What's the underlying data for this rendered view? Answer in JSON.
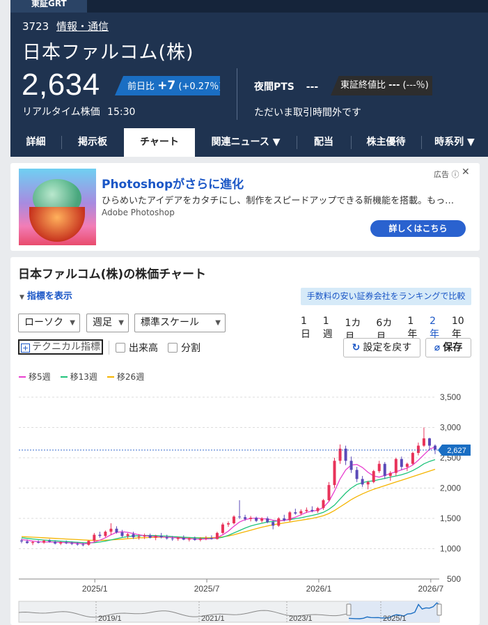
{
  "header": {
    "market": "東証GRT",
    "code": "3723",
    "industry": "情報・通信",
    "company": "日本ファルコム(株)",
    "price": "2,634",
    "change_label": "前日比",
    "change_value": "+7",
    "change_pct": "(+0.27％)",
    "realtime_label": "リアルタイム株価",
    "realtime_time": "15:30",
    "pts_label": "夜間PTS",
    "pts_value": "---",
    "close_label": "東証終値比",
    "close_value": "---",
    "close_pct": "(---％)",
    "notrade": "ただいま取引時間外です"
  },
  "tabs": [
    {
      "label": "詳細"
    },
    {
      "label": "掲示板"
    },
    {
      "label": "チャート"
    },
    {
      "label": "関連ニュース ▼"
    },
    {
      "label": "配当"
    },
    {
      "label": "株主優待"
    },
    {
      "label": "時系列 ▼"
    }
  ],
  "ad": {
    "title": "Photoshopがさらに進化",
    "text": "ひらめいたアイデアをカタチにし、制作をスピードアップできる新機能を搭載。もっ…",
    "brand": "Adobe Photoshop",
    "label": "広告",
    "button": "詳しくはこちら"
  },
  "controls": {
    "title": "日本ファルコム(株)の株価チャート",
    "indicator_link": "指標を表示",
    "broker_button": "手数料の安い証券会社をランキングで比較",
    "chart_type": "ローソク",
    "interval": "週足",
    "scale": "標準スケール",
    "periods": [
      "1日",
      "1週",
      "1カ月",
      "6カ月",
      "1年",
      "2年",
      "10年"
    ],
    "active_period": "2年",
    "tech_button": "テクニカル指標",
    "volume_label": "出来高",
    "split_label": "分割",
    "reset_button": "設定を戻す",
    "save_button": "保存"
  },
  "chart_data": {
    "type": "candlestick",
    "series": [
      {
        "name": "移5週",
        "color": "#e83fcf"
      },
      {
        "name": "移13週",
        "color": "#1fc37a"
      },
      {
        "name": "移26週",
        "color": "#f5b400"
      }
    ],
    "yticks": [
      "3,500",
      "3,000",
      "2,500",
      "2,000",
      "1,500",
      "1,000",
      "500"
    ],
    "ylim": [
      500,
      3500
    ],
    "xticks": [
      "2025/1",
      "2025/7",
      "2026/1",
      "2026/7"
    ],
    "last_price_label": "2,627",
    "last_price": 2627,
    "ohlc": [
      [
        1135,
        1165,
        1090,
        1120
      ],
      [
        1120,
        1150,
        1080,
        1095
      ],
      [
        1095,
        1130,
        1060,
        1110
      ],
      [
        1110,
        1140,
        1085,
        1100
      ],
      [
        1100,
        1150,
        1080,
        1130
      ],
      [
        1130,
        1160,
        1100,
        1115
      ],
      [
        1115,
        1140,
        1070,
        1085
      ],
      [
        1085,
        1120,
        1060,
        1105
      ],
      [
        1105,
        1135,
        1075,
        1090
      ],
      [
        1090,
        1120,
        1060,
        1080
      ],
      [
        1080,
        1110,
        1050,
        1070
      ],
      [
        1070,
        1100,
        1040,
        1065
      ],
      [
        1065,
        1140,
        1050,
        1130
      ],
      [
        1130,
        1260,
        1110,
        1230
      ],
      [
        1230,
        1280,
        1180,
        1210
      ],
      [
        1210,
        1300,
        1190,
        1280
      ],
      [
        1280,
        1420,
        1230,
        1330
      ],
      [
        1330,
        1370,
        1250,
        1270
      ],
      [
        1270,
        1310,
        1190,
        1210
      ],
      [
        1210,
        1260,
        1170,
        1240
      ],
      [
        1240,
        1280,
        1160,
        1190
      ],
      [
        1190,
        1240,
        1150,
        1200
      ],
      [
        1200,
        1250,
        1160,
        1220
      ],
      [
        1220,
        1250,
        1170,
        1180
      ],
      [
        1180,
        1230,
        1140,
        1210
      ],
      [
        1210,
        1260,
        1170,
        1190
      ],
      [
        1190,
        1230,
        1150,
        1170
      ],
      [
        1170,
        1210,
        1130,
        1160
      ],
      [
        1160,
        1200,
        1130,
        1180
      ],
      [
        1180,
        1220,
        1140,
        1150
      ],
      [
        1150,
        1190,
        1120,
        1170
      ],
      [
        1170,
        1200,
        1130,
        1145
      ],
      [
        1145,
        1190,
        1120,
        1165
      ],
      [
        1165,
        1210,
        1140,
        1175
      ],
      [
        1175,
        1220,
        1150,
        1160
      ],
      [
        1160,
        1280,
        1150,
        1260
      ],
      [
        1260,
        1430,
        1240,
        1400
      ],
      [
        1400,
        1450,
        1360,
        1420
      ],
      [
        1420,
        1550,
        1400,
        1530
      ],
      [
        1530,
        1800,
        1490,
        1520
      ],
      [
        1520,
        1560,
        1460,
        1490
      ],
      [
        1490,
        1540,
        1450,
        1510
      ],
      [
        1510,
        1530,
        1440,
        1460
      ],
      [
        1460,
        1520,
        1430,
        1500
      ],
      [
        1500,
        1530,
        1420,
        1440
      ],
      [
        1440,
        1470,
        1320,
        1380
      ],
      [
        1380,
        1520,
        1360,
        1500
      ],
      [
        1500,
        1560,
        1450,
        1470
      ],
      [
        1470,
        1620,
        1450,
        1600
      ],
      [
        1600,
        1660,
        1560,
        1580
      ],
      [
        1580,
        1650,
        1550,
        1620
      ],
      [
        1620,
        1680,
        1590,
        1640
      ],
      [
        1640,
        1700,
        1600,
        1620
      ],
      [
        1620,
        1690,
        1590,
        1670
      ],
      [
        1670,
        1820,
        1640,
        1800
      ],
      [
        1800,
        2100,
        1780,
        2050
      ],
      [
        2050,
        2500,
        2000,
        2450
      ],
      [
        2450,
        2720,
        2400,
        2650
      ],
      [
        2650,
        2700,
        2380,
        2450
      ],
      [
        2450,
        2520,
        2250,
        2300
      ],
      [
        2300,
        2350,
        2100,
        2150
      ],
      [
        2150,
        2200,
        2020,
        2060
      ],
      [
        2060,
        2120,
        1980,
        2100
      ],
      [
        2100,
        2300,
        2080,
        2280
      ],
      [
        2280,
        2450,
        2250,
        2400
      ],
      [
        2400,
        2430,
        2150,
        2200
      ],
      [
        2200,
        2280,
        2120,
        2250
      ],
      [
        2250,
        2500,
        2200,
        2480
      ],
      [
        2480,
        2520,
        2300,
        2350
      ],
      [
        2350,
        2420,
        2280,
        2400
      ],
      [
        2400,
        2600,
        2380,
        2580
      ],
      [
        2580,
        2750,
        2540,
        2700
      ],
      [
        2700,
        3000,
        2680,
        2820
      ],
      [
        2820,
        2830,
        2620,
        2700
      ],
      [
        2700,
        2720,
        2560,
        2634
      ]
    ],
    "ma5": [
      1150,
      1140,
      1125,
      1115,
      1110,
      1110,
      1108,
      1105,
      1100,
      1095,
      1090,
      1080,
      1085,
      1110,
      1140,
      1180,
      1230,
      1270,
      1280,
      1270,
      1250,
      1230,
      1215,
      1205,
      1200,
      1195,
      1190,
      1185,
      1178,
      1170,
      1165,
      1160,
      1158,
      1160,
      1165,
      1185,
      1230,
      1290,
      1370,
      1440,
      1480,
      1500,
      1505,
      1495,
      1490,
      1470,
      1460,
      1465,
      1490,
      1520,
      1560,
      1600,
      1620,
      1635,
      1680,
      1780,
      1950,
      2150,
      2300,
      2380,
      2390,
      2340,
      2260,
      2200,
      2180,
      2210,
      2240,
      2270,
      2300,
      2330,
      2380,
      2460,
      2550,
      2640,
      2680
    ],
    "ma13": [
      1180,
      1170,
      1160,
      1150,
      1142,
      1136,
      1130,
      1124,
      1118,
      1112,
      1106,
      1100,
      1098,
      1100,
      1110,
      1125,
      1145,
      1165,
      1185,
      1200,
      1210,
      1215,
      1218,
      1218,
      1216,
      1212,
      1208,
      1200,
      1195,
      1190,
      1185,
      1180,
      1175,
      1172,
      1170,
      1172,
      1190,
      1220,
      1260,
      1300,
      1340,
      1375,
      1400,
      1420,
      1440,
      1450,
      1460,
      1470,
      1480,
      1495,
      1510,
      1530,
      1550,
      1570,
      1600,
      1650,
      1720,
      1820,
      1920,
      2000,
      2060,
      2090,
      2110,
      2120,
      2140,
      2160,
      2180,
      2200,
      2220,
      2250,
      2290,
      2340,
      2400,
      2440,
      2470
    ],
    "ma26": [
      1200,
      1195,
      1190,
      1185,
      1180,
      1175,
      1170,
      1165,
      1160,
      1155,
      1150,
      1145,
      1140,
      1138,
      1138,
      1140,
      1145,
      1150,
      1158,
      1165,
      1172,
      1178,
      1182,
      1185,
      1188,
      1190,
      1190,
      1188,
      1186,
      1184,
      1182,
      1180,
      1180,
      1180,
      1182,
      1186,
      1195,
      1210,
      1230,
      1255,
      1280,
      1305,
      1330,
      1355,
      1375,
      1395,
      1410,
      1425,
      1440,
      1455,
      1470,
      1485,
      1500,
      1520,
      1545,
      1580,
      1630,
      1690,
      1750,
      1810,
      1860,
      1905,
      1945,
      1980,
      2010,
      2040,
      2070,
      2100,
      2130,
      2160,
      2190,
      2220,
      2250,
      2280,
      2310
    ],
    "navigator": {
      "xticks": [
        "2019/1",
        "2021/1",
        "2023/1",
        "2025/1"
      ]
    }
  }
}
